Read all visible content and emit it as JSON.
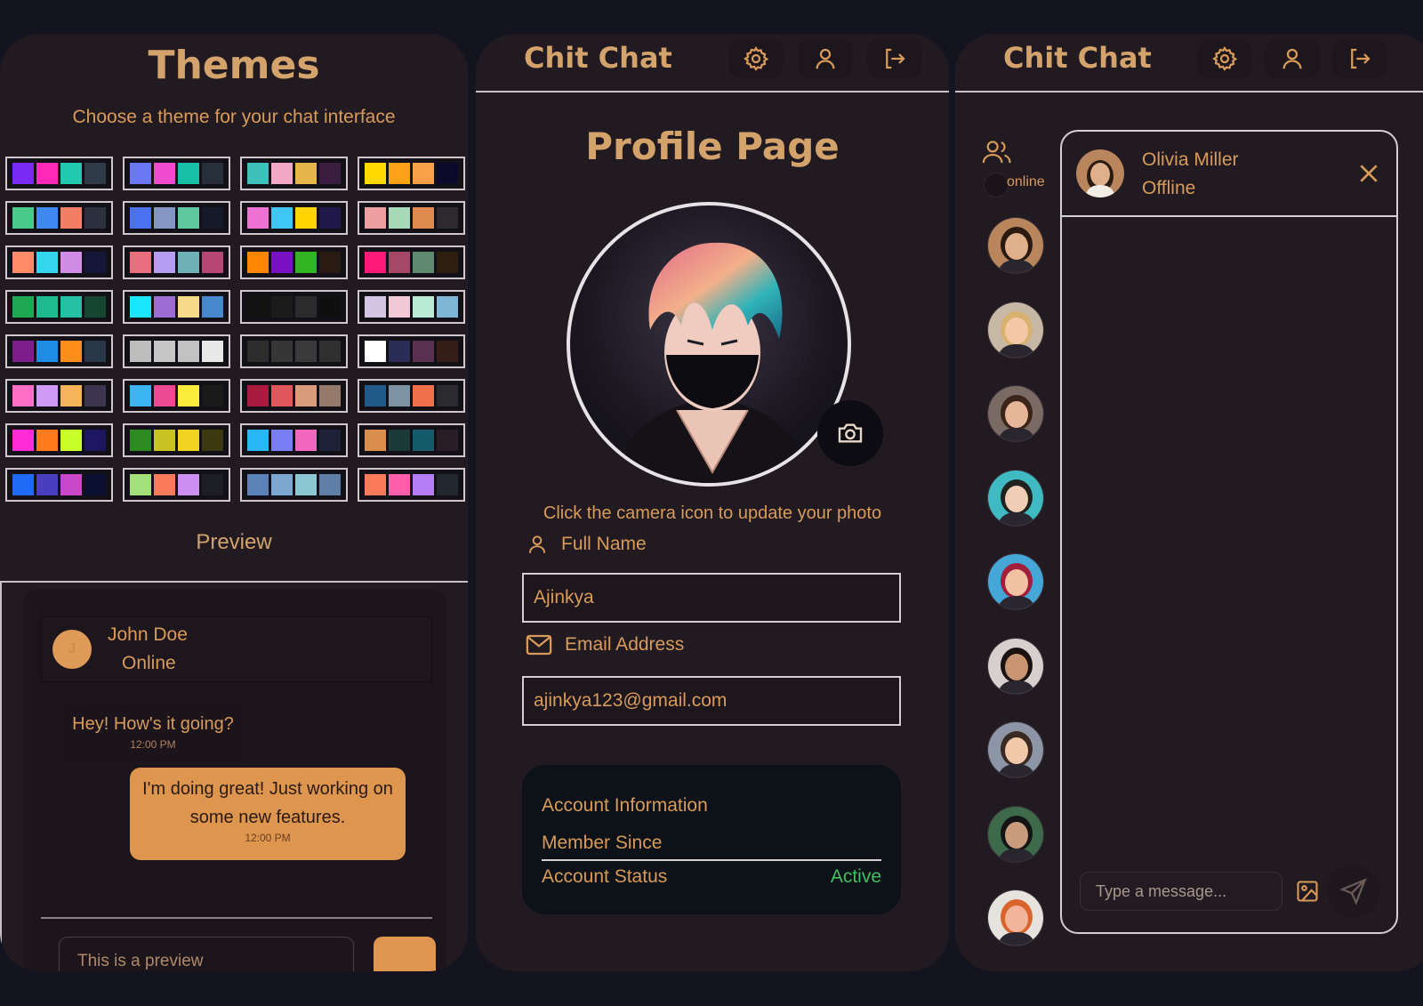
{
  "colors": {
    "background": "#131420",
    "panel": "#221a21",
    "accent": "#d89b5a",
    "bubble_out": "#de954e",
    "active_green": "#3fbf5f"
  },
  "themes": {
    "title": "Themes",
    "subtitle": "Choose a theme for your chat interface",
    "preview_label": "Preview",
    "swatches": [
      [
        "#7a2af5",
        "#ff29b8",
        "#22c9b1",
        "#2f3a48"
      ],
      [
        "#6a78f5",
        "#f04ccf",
        "#17c1a8",
        "#27303a"
      ],
      [
        "#3fc0bd",
        "#f2a8c5",
        "#e6b64a",
        "#3b1d42"
      ],
      [
        "#ffd900",
        "#ffa21a",
        "#f7a048",
        "#0b0a2a"
      ],
      [
        "#49c98a",
        "#4088f2",
        "#f27e63",
        "#2c3140"
      ],
      [
        "#4c71f0",
        "#8396c4",
        "#5fc89e",
        "#151a2a"
      ],
      [
        "#ee72d4",
        "#3fc6f2",
        "#ffd400",
        "#21184a"
      ],
      [
        "#ed9e9e",
        "#a7d8b7",
        "#e08a52",
        "#2d2a2e"
      ],
      [
        "#ff8b6b",
        "#33d5ef",
        "#d08de8",
        "#14163a"
      ],
      [
        "#ea6e7e",
        "#b59ef2",
        "#6fb1b6",
        "#b64674"
      ],
      [
        "#ff8600",
        "#7a10c4",
        "#30b521",
        "#2a1b12"
      ],
      [
        "#ff1a78",
        "#a54766",
        "#5f8a72",
        "#2d1f10"
      ],
      [
        "#1ea852",
        "#1eba8f",
        "#23c0a4",
        "#164632"
      ],
      [
        "#1ae6ff",
        "#9b6cd1",
        "#f7d98a",
        "#4787cc"
      ],
      [
        "#111111",
        "#1b1b1b",
        "#2b2b2b",
        "#0f0f0f"
      ],
      [
        "#d4c6e2",
        "#f2c8d6",
        "#b8ead4",
        "#7fb6d6"
      ],
      [
        "#7d1e8c",
        "#1e8de6",
        "#ff8d1a",
        "#283848"
      ],
      [
        "#bdbdbd",
        "#c6c6c6",
        "#c2c2c2",
        "#e8e8e8"
      ],
      [
        "#2d2d2d",
        "#363636",
        "#3a3a3a",
        "#303030"
      ],
      [
        "#ffffff",
        "#2a2d55",
        "#5a3050",
        "#351d18"
      ],
      [
        "#ff6fc5",
        "#cf9af5",
        "#f7b35a",
        "#3b3550"
      ],
      [
        "#3ab7f3",
        "#ec4b94",
        "#faec3a",
        "#1a1a1a"
      ],
      [
        "#a81a3e",
        "#e0575b",
        "#d99b7a",
        "#957a6a"
      ],
      [
        "#1f5a8a",
        "#7b93a3",
        "#f0704a",
        "#2b2a2e"
      ],
      [
        "#ff2bd6",
        "#ff7a1a",
        "#c8ff2a",
        "#1e1660"
      ],
      [
        "#2d8a22",
        "#c7c322",
        "#f2d322",
        "#3c3810"
      ],
      [
        "#28b8f7",
        "#7a7ef5",
        "#f266c0",
        "#1e2238"
      ],
      [
        "#d98e4e",
        "#1d3a3b",
        "#155a6b",
        "#2a1d25"
      ],
      [
        "#1f6bf5",
        "#4a3ec0",
        "#c946c8",
        "#0b1033"
      ],
      [
        "#a3e07a",
        "#fb7a5a",
        "#cc8ff0",
        "#1c1e24"
      ],
      [
        "#5b82b8",
        "#7ba7d0",
        "#8ac7d3",
        "#5e7ea6"
      ],
      [
        "#ff7a5a",
        "#ff5eaa",
        "#b47df5",
        "#22282f"
      ]
    ],
    "preview": {
      "contact_initial": "J",
      "contact_name": "John Doe",
      "contact_status": "Online",
      "msg_in_text": "Hey! How's it going?",
      "msg_in_time": "12:00 PM",
      "msg_out_text": "I'm doing great! Just working on some new features.",
      "msg_out_time": "12:00 PM",
      "input_placeholder": "This is a preview"
    }
  },
  "profile": {
    "app_title": "Chit Chat",
    "page_title": "Profile Page",
    "photo_hint": "Click the camera icon to update your photo",
    "full_name_label": "Full Name",
    "full_name_value": "Ajinkya",
    "email_label": "Email Address",
    "email_value": "ajinkya123@gmail.com",
    "account_info_title": "Account Information",
    "member_since_label": "Member Since",
    "account_status_label": "Account Status",
    "account_status_value": "Active"
  },
  "chat": {
    "app_title": "Chit Chat",
    "online_label": "online",
    "contacts": [
      {
        "icon": "avatar-woman-1",
        "bg": "#b9855c",
        "skin": "#e0b08a",
        "hair": "#2a1a10"
      },
      {
        "icon": "avatar-woman-2",
        "bg": "#c7b8a6",
        "skin": "#f2c9a4",
        "hair": "#d8b070"
      },
      {
        "icon": "avatar-woman-3",
        "bg": "#7a6a64",
        "skin": "#e6b69a",
        "hair": "#3b2418"
      },
      {
        "icon": "avatar-man-1",
        "bg": "#3fbac2",
        "skin": "#f0cdb5",
        "hair": "#20221e"
      },
      {
        "icon": "avatar-woman-4",
        "bg": "#45a7d8",
        "skin": "#f2c2a2",
        "hair": "#a21e3a"
      },
      {
        "icon": "avatar-woman-5",
        "bg": "#d8cfcf",
        "skin": "#c99472",
        "hair": "#1a1210"
      },
      {
        "icon": "avatar-man-2",
        "bg": "#8c96a6",
        "skin": "#f0c8aa",
        "hair": "#3a2a22"
      },
      {
        "icon": "avatar-man-3",
        "bg": "#3c6a4a",
        "skin": "#c89c7c",
        "hair": "#141414"
      },
      {
        "icon": "avatar-man-4",
        "bg": "#e6e2de",
        "skin": "#f2b49a",
        "hair": "#d9632a"
      }
    ],
    "active_contact": {
      "name": "Olivia Miller",
      "status": "Offline"
    },
    "message_placeholder": "Type a message..."
  }
}
